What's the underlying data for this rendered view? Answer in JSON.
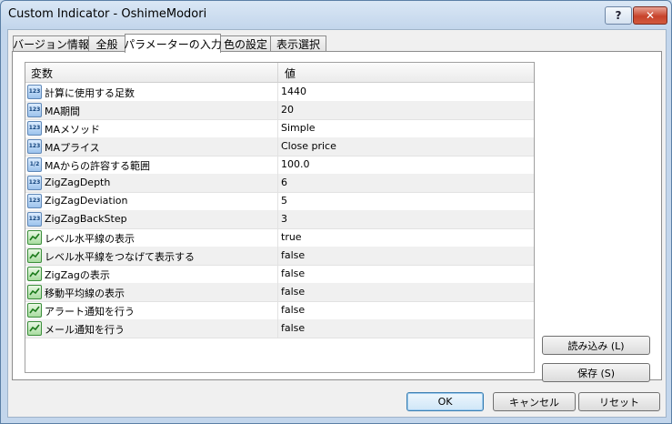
{
  "window": {
    "title": "Custom Indicator - OshimeModori",
    "help_label": "?",
    "close_label": "✕"
  },
  "tabs": [
    {
      "label": "バージョン情報"
    },
    {
      "label": "全般"
    },
    {
      "label": "パラメーターの入力"
    },
    {
      "label": "色の設定"
    },
    {
      "label": "表示選択"
    }
  ],
  "grid": {
    "headers": {
      "variable": "変数",
      "value": "値"
    },
    "rows": [
      {
        "icon": "123",
        "name": "計算に使用する足数",
        "value": "1440"
      },
      {
        "icon": "123",
        "name": "MA期間",
        "value": "20"
      },
      {
        "icon": "123",
        "name": "MAメソッド",
        "value": "Simple"
      },
      {
        "icon": "123",
        "name": "MAプライス",
        "value": "Close price"
      },
      {
        "icon": "1/2",
        "name": "MAからの許容する範囲",
        "value": "100.0"
      },
      {
        "icon": "123",
        "name": "ZigZagDepth",
        "value": "6"
      },
      {
        "icon": "123",
        "name": "ZigZagDeviation",
        "value": "5"
      },
      {
        "icon": "123",
        "name": "ZigZagBackStep",
        "value": "3"
      },
      {
        "icon": "bool",
        "name": "レベル水平線の表示",
        "value": "true"
      },
      {
        "icon": "bool",
        "name": "レベル水平線をつなげて表示する",
        "value": "false"
      },
      {
        "icon": "bool",
        "name": "ZigZagの表示",
        "value": "false"
      },
      {
        "icon": "bool",
        "name": "移動平均線の表示",
        "value": "false"
      },
      {
        "icon": "bool",
        "name": "アラート通知を行う",
        "value": "false"
      },
      {
        "icon": "bool",
        "name": "メール通知を行う",
        "value": "false"
      }
    ]
  },
  "side_buttons": {
    "load": "読み込み (L)",
    "save": "保存 (S)"
  },
  "footer_buttons": {
    "ok": "OK",
    "cancel": "キャンセル",
    "reset": "リセット"
  }
}
